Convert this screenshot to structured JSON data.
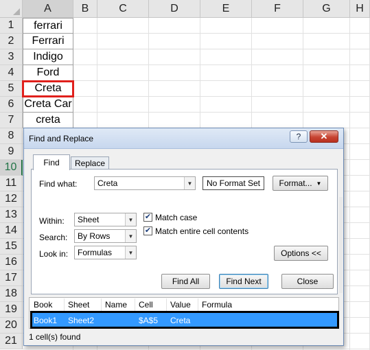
{
  "spreadsheet": {
    "columns": [
      "A",
      "B",
      "C",
      "D",
      "E",
      "F",
      "G",
      "H"
    ],
    "rows": [
      "1",
      "2",
      "3",
      "4",
      "5",
      "6",
      "7",
      "8",
      "9",
      "10",
      "11",
      "12",
      "13",
      "14",
      "15",
      "16",
      "17",
      "18",
      "19",
      "20",
      "21"
    ],
    "active_row": "10",
    "column_a_values": [
      "ferrari",
      "Ferrari",
      "Indigo",
      "Ford",
      "Creta",
      "Creta Car",
      "creta"
    ]
  },
  "dialog": {
    "title": "Find and Replace",
    "help_label": "?",
    "close_label": "✕",
    "tabs": [
      {
        "label": "Find",
        "selected": true
      },
      {
        "label": "Replace",
        "selected": false
      }
    ],
    "find_what_label": "Find what:",
    "find_what_value": "Creta",
    "no_format_label": "No Format Set",
    "format_button": "Format...",
    "within_label": "Within:",
    "within_value": "Sheet",
    "search_label": "Search:",
    "search_value": "By Rows",
    "look_in_label": "Look in:",
    "look_in_value": "Formulas",
    "match_case_label": "Match case",
    "match_case_checked": true,
    "match_entire_label": "Match entire cell contents",
    "match_entire_checked": true,
    "options_button": "Options <<",
    "find_all_button": "Find All",
    "find_next_button": "Find Next",
    "close_button": "Close",
    "results_headers": [
      "Book",
      "Sheet",
      "Name",
      "Cell",
      "Value",
      "Formula"
    ],
    "results_rows": [
      {
        "book": "Book1",
        "sheet": "Sheet2",
        "name": "",
        "cell": "$A$5",
        "value": "Creta",
        "formula": ""
      }
    ],
    "status_text": "1 cell(s) found"
  },
  "colors": {
    "selection_red": "#e0201c",
    "result_highlight": "#3399ff",
    "excel_green": "#217346"
  }
}
